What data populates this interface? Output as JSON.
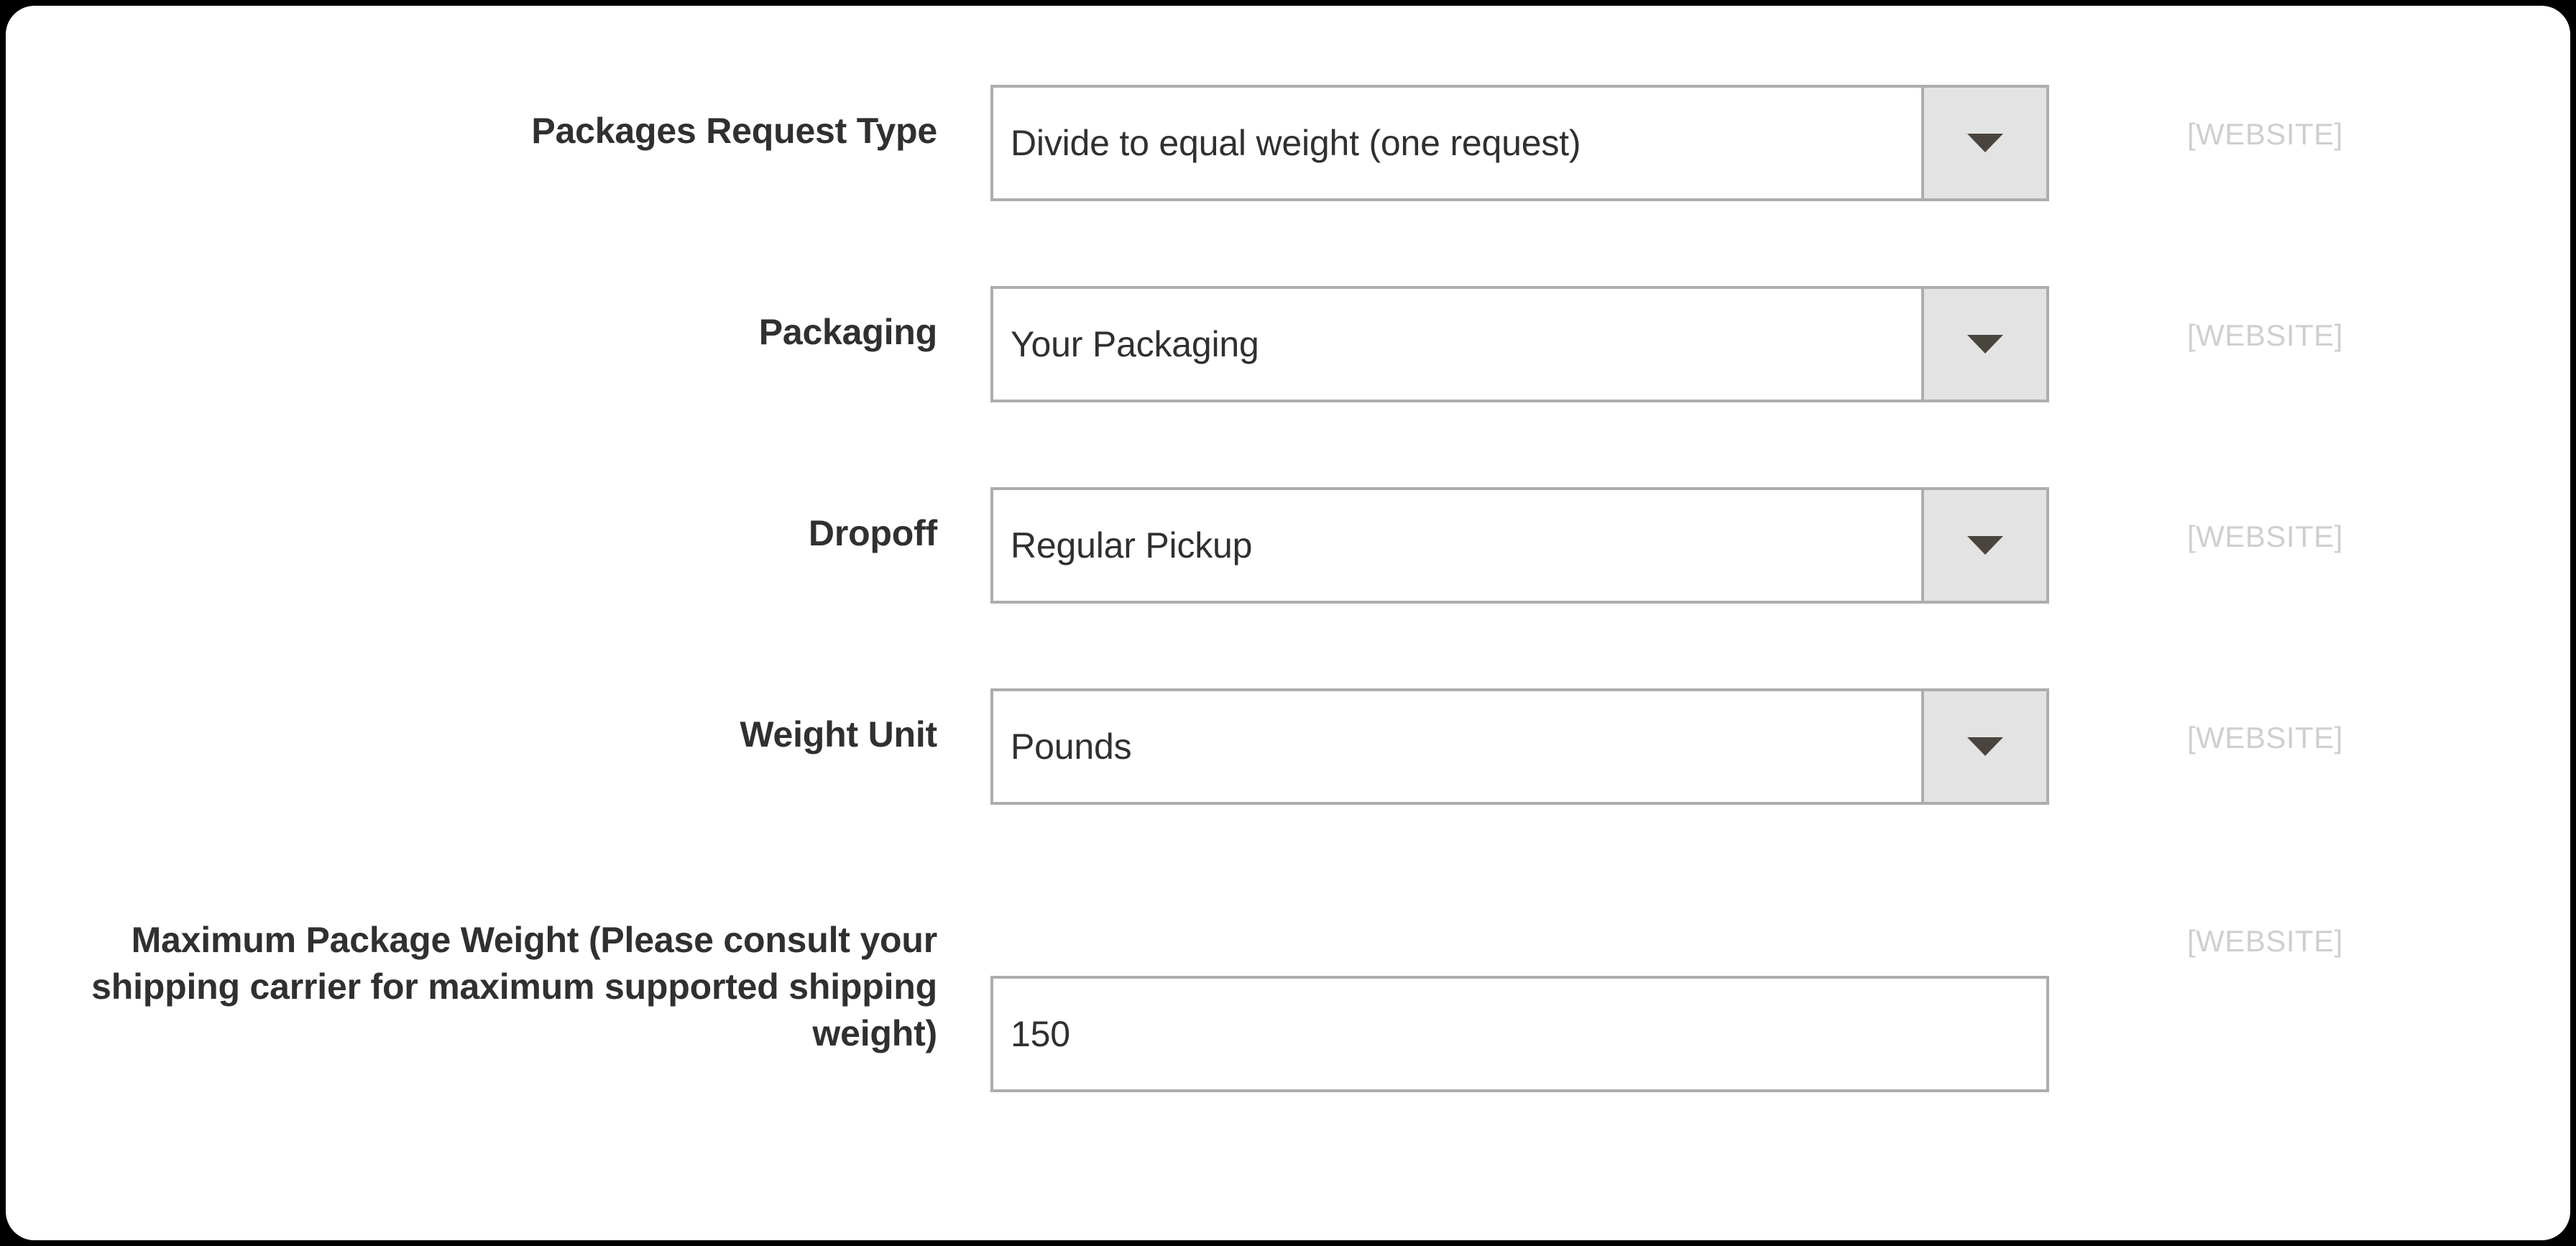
{
  "form": {
    "scope_label": "[WEBSITE]",
    "dropdown_icon": "chevron-down-icon",
    "fields": [
      {
        "id": "packages-request-type",
        "label": "Packages Request Type",
        "type": "select",
        "value": "Divide to equal weight (one request)",
        "scope": "[WEBSITE]"
      },
      {
        "id": "packaging",
        "label": "Packaging",
        "type": "select",
        "value": "Your Packaging",
        "scope": "[WEBSITE]"
      },
      {
        "id": "dropoff",
        "label": "Dropoff",
        "type": "select",
        "value": "Regular Pickup",
        "scope": "[WEBSITE]"
      },
      {
        "id": "weight-unit",
        "label": "Weight Unit",
        "type": "select",
        "value": "Pounds",
        "scope": "[WEBSITE]"
      },
      {
        "id": "maximum-package-weight",
        "label": "Maximum Package Weight (Please consult your shipping carrier for maximum supported shipping weight)",
        "type": "text",
        "value": "150",
        "scope": "[WEBSITE]"
      }
    ]
  },
  "colors": {
    "text": "#303030",
    "border": "#adadad",
    "button_face": "#e3e3e3",
    "caret": "#4a443f",
    "scope_text": "#cfcfcf",
    "card_background": "#ffffff",
    "page_background": "#000000"
  }
}
